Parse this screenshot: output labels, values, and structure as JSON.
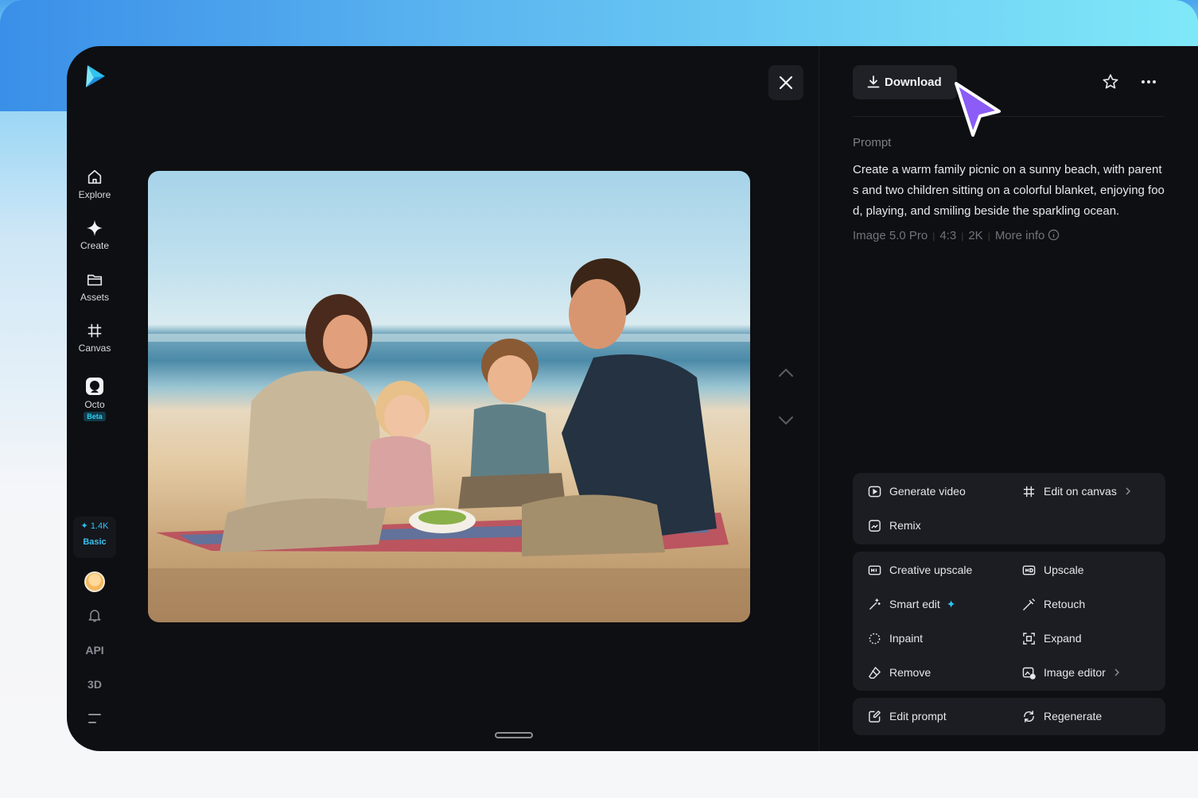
{
  "sidebar": {
    "nav": [
      {
        "label": "Explore",
        "icon": "home-icon"
      },
      {
        "label": "Create",
        "icon": "sparkle-icon"
      },
      {
        "label": "Assets",
        "icon": "folder-icon"
      },
      {
        "label": "Canvas",
        "icon": "canvas-icon"
      },
      {
        "label": "Octo",
        "icon": "octo-icon",
        "badge": "Beta"
      }
    ],
    "credits": {
      "amount": "1.4K",
      "plan": "Basic"
    },
    "api_label": "API",
    "threed_label": "3D"
  },
  "toolbar": {
    "download_label": "Download"
  },
  "details": {
    "prompt_label": "Prompt",
    "prompt_text": "Create a warm family picnic on a sunny beach, with parents and two children sitting on a colorful blanket, enjoying food, playing, and smiling beside the sparkling ocean.",
    "model": "Image 5.0 Pro",
    "ratio": "4:3",
    "resolution": "2K",
    "more_info": "More info"
  },
  "actions": {
    "group1": [
      "Generate video",
      "Edit on canvas",
      "Remix"
    ],
    "group2": [
      "Creative upscale",
      "Upscale",
      "Smart edit",
      "Retouch",
      "Inpaint",
      "Expand",
      "Remove",
      "Image editor"
    ],
    "group3": [
      "Edit prompt",
      "Regenerate"
    ]
  },
  "colors": {
    "app_bg": "#0e0f12",
    "card_bg": "#1b1d22",
    "accent": "#2fc3f0",
    "cursor": "#8b5cf6"
  }
}
